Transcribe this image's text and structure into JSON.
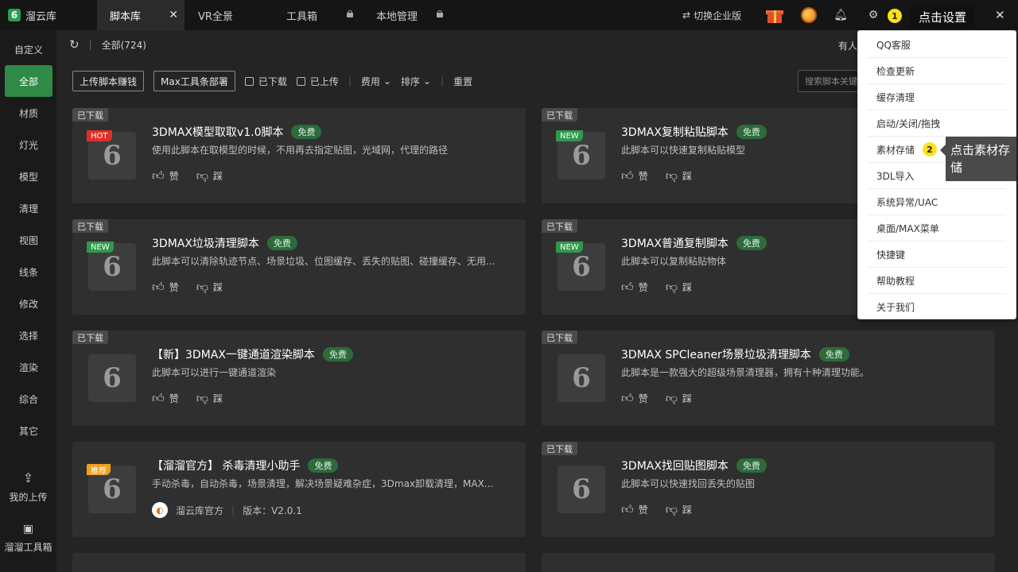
{
  "app": {
    "logo_mark": "6",
    "logo_text": "溜云库",
    "tabs": [
      {
        "label": "脚本库",
        "active": true,
        "close": "✕"
      },
      {
        "label": "VR全景"
      },
      {
        "label": "工具箱",
        "locked": true
      },
      {
        "label": "本地管理",
        "locked": true
      }
    ],
    "switch_enterprise": "切换企业版",
    "callout_settings": "点击设置",
    "step1": "1",
    "step2": "2"
  },
  "sidebar": {
    "items": [
      "自定义",
      "全部",
      "材质",
      "灯光",
      "模型",
      "清理",
      "视图",
      "线条",
      "修改",
      "选择",
      "渲染",
      "综合",
      "其它"
    ],
    "my_upload": "我的上传",
    "toolbox": "溜溜工具箱"
  },
  "main": {
    "breadcrumb": "全部(724)",
    "youren": "有人",
    "upload_btn": "上传脚本赚钱",
    "max_btn": "Max工具条部署",
    "downloaded": "已下载",
    "uploaded": "已上传",
    "fee": "费用",
    "sort": "排序",
    "reset": "重置",
    "search_placeholder": "搜索脚本关键"
  },
  "cards": [
    {
      "downloaded": "已下载",
      "tag": "HOT",
      "title": "3DMAX模型取取v1.0脚本",
      "free": "免费",
      "desc": "使用此脚本在取模型的时候，不用再去指定贴图，光域网，代理的路径",
      "like": "赞",
      "dislike": "踩"
    },
    {
      "downloaded": "已下载",
      "tag": "NEW",
      "title": "3DMAX复制粘贴脚本",
      "free": "免费",
      "desc": "此脚本可以快速复制粘贴模型",
      "like": "赞",
      "dislike": "踩"
    },
    {
      "downloaded": "已下载",
      "tag": "NEW",
      "title": "3DMAX垃圾清理脚本",
      "free": "免费",
      "desc": "此脚本可以清除轨迹节点、场景垃圾、位图缓存、丢失的贴图、碰撞缓存、无用...",
      "like": "赞",
      "dislike": "踩"
    },
    {
      "downloaded": "已下载",
      "tag": "NEW",
      "title": "3DMAX普通复制脚本",
      "free": "免费",
      "desc": "此脚本可以复制粘贴物体",
      "like": "赞",
      "dislike": "踩"
    },
    {
      "downloaded": "已下载",
      "tag": "",
      "title": "【新】3DMAX一键通道渲染脚本",
      "free": "免费",
      "desc": "此脚本可以进行一键通道渲染",
      "like": "赞",
      "dislike": "踩"
    },
    {
      "downloaded": "已下载",
      "tag": "",
      "title": "3DMAX SPCleaner场景垃圾清理脚本",
      "free": "免费",
      "desc": "此脚本是一款强大的超级场景清理器，拥有十种清理功能。",
      "like": "赞",
      "dislike": "踩"
    },
    {
      "downloaded": "",
      "tag": "推荐",
      "title": "【溜溜官方】 杀毒清理小助手",
      "free": "免费",
      "desc": "手动杀毒，自动杀毒，场景清理，解决场景疑难杂症，3Dmax卸载清理，MAX...",
      "author": "溜云库官方",
      "version": "版本：V2.0.1"
    },
    {
      "downloaded": "已下载",
      "tag": "",
      "title": "3DMAX找回贴图脚本",
      "free": "免费",
      "desc": "此脚本可以快速找回丢失的贴图",
      "like": "赞",
      "dislike": "踩"
    }
  ],
  "menu": {
    "items": [
      "QQ客服",
      "检查更新",
      "缓存清理",
      "启动/关闭/拖拽",
      "素材存储",
      "3DL导入",
      "系统异常/UAC",
      "桌面/MAX菜单",
      "快捷键",
      "帮助教程",
      "关于我们"
    ],
    "callout": "点击素材存储"
  }
}
